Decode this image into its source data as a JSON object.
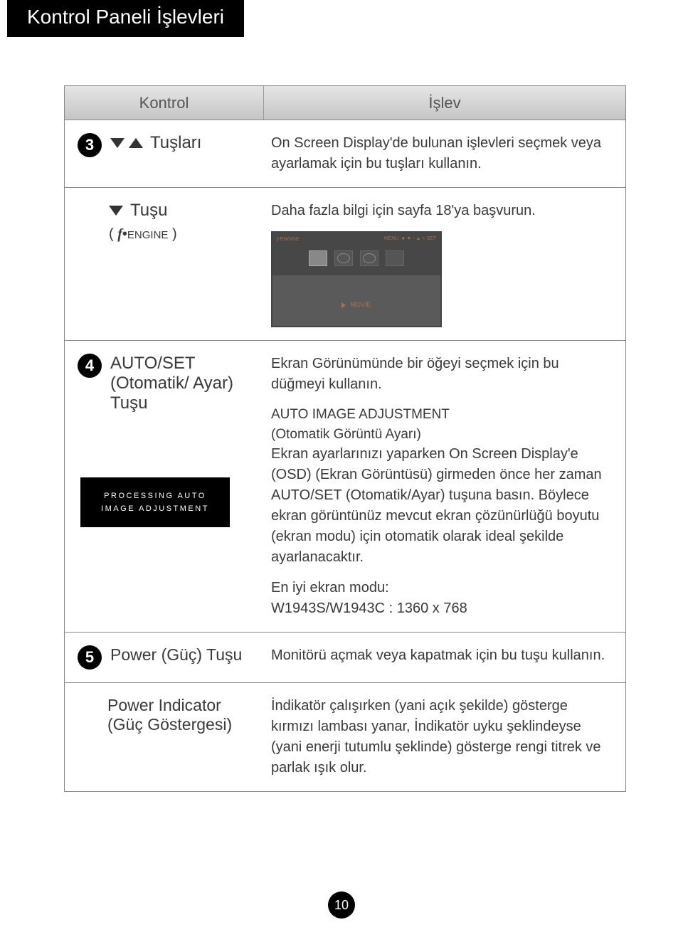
{
  "page_title": "Kontrol Paneli İşlevleri",
  "header": {
    "control": "Kontrol",
    "func": "İşlev"
  },
  "row3": {
    "num": "3",
    "label_suffix": "Tuşları",
    "desc": "On Screen Display'de bulunan işlevleri seçmek veya ayarlamak için bu tuşları kullanın."
  },
  "row3b": {
    "label_suffix": "Tuşu",
    "engine_prefix": "(",
    "engine_symbol": "f",
    "engine_dot": "•",
    "engine_label": "ENGINE",
    "engine_suffix": ")",
    "desc": "Daha fazla bilgi için sayfa 18'ya başvurun.",
    "osd": {
      "title_sym": "f",
      "title_dot": "·",
      "title": "ENGINE",
      "menu": "MENU",
      "set": "SET",
      "movie": "MOVIE"
    }
  },
  "row4": {
    "num": "4",
    "title_line1": "AUTO/SET",
    "title_line2": "(Otomatik/ Ayar)",
    "title_line3": "Tuşu",
    "processing_line1": "PROCESSING AUTO",
    "processing_line2": "IMAGE ADJUSTMENT",
    "desc1": "Ekran Görünümünde bir öğeyi seçmek için bu düğmeyi kullanın.",
    "sub_title": "AUTO IMAGE ADJUSTMENT",
    "sub_sub": "(Otomatik Görüntü Ayarı)",
    "desc2": "Ekran ayarlarınızı yaparken On Screen Display'e (OSD) (Ekran Görüntüsü) girmeden önce her zaman AUTO/SET (Otomatik/Ayar) tuşuna basın. Böylece ekran görüntünüz mevcut ekran çözünürlüğü boyutu (ekran modu) için otomatik olarak ideal şekilde ayarlanacaktır.",
    "desc3_label": "En iyi ekran modu:",
    "desc3_value": "W1943S/W1943C : 1360 x 768"
  },
  "row5": {
    "num": "5",
    "label": "Power (Güç) Tuşu",
    "desc": "Monitörü açmak veya kapatmak için bu tuşu kullanın."
  },
  "row5b": {
    "label_line1": "Power Indicator",
    "label_line2": "(Güç Göstergesi)",
    "desc": "İndikatör çalışırken (yani açık şekilde) gösterge kırmızı lambası yanar, İndikatör uyku şeklindeyse (yani enerji tutumlu şeklinde) gösterge rengi titrek ve parlak ışık olur."
  },
  "page_number": "10",
  "chart_data": {
    "type": "table",
    "title": "Kontrol Paneli İşlevleri",
    "columns": [
      "Kontrol",
      "İşlev"
    ],
    "rows": [
      {
        "control": "▼▲ Tuşları",
        "function": "On Screen Display'de bulunan işlevleri seçmek veya ayarlamak için bu tuşları kullanın."
      },
      {
        "control": "▼ Tuşu (f·ENGINE)",
        "function": "Daha fazla bilgi için sayfa 18'ya başvurun."
      },
      {
        "control": "AUTO/SET (Otomatik/ Ayar) Tuşu",
        "function": "Ekran Görünümünde bir öğeyi seçmek için bu düğmeyi kullanın. AUTO IMAGE ADJUSTMENT (Otomatik Görüntü Ayarı): Ekran ayarlarınızı yaparken On Screen Display'e (OSD) (Ekran Görüntüsü) girmeden önce her zaman AUTO/SET (Otomatik/Ayar) tuşuna basın. Böylece ekran görüntünüz mevcut ekran çözünürlüğü boyutu (ekran modu) için otomatik olarak ideal şekilde ayarlanacaktır. En iyi ekran modu: W1943S/W1943C : 1360 x 768"
      },
      {
        "control": "Power (Güç) Tuşu",
        "function": "Monitörü açmak veya kapatmak için bu tuşu kullanın."
      },
      {
        "control": "Power Indicator (Güç Göstergesi)",
        "function": "İndikatör çalışırken (yani açık şekilde) gösterge kırmızı lambası yanar, İndikatör uyku şeklindeyse (yani enerji tutumlu şeklinde) gösterge rengi titrek ve parlak ışık olur."
      }
    ]
  }
}
